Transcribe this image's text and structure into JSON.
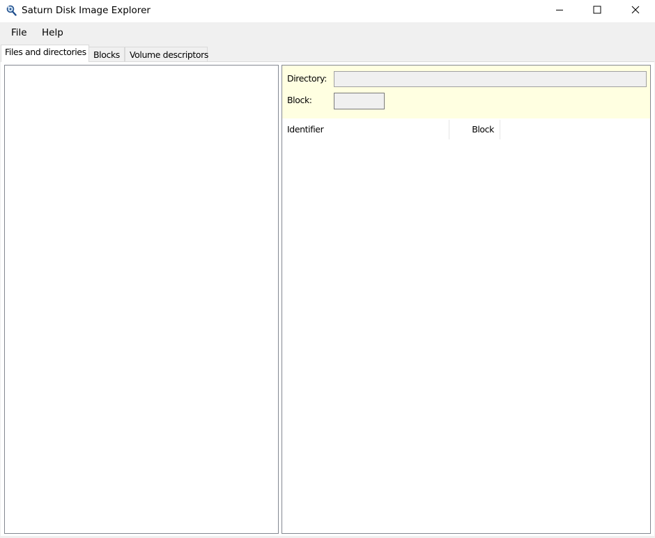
{
  "window": {
    "title": "Saturn Disk Image Explorer",
    "icon": "magnifier-disk-icon",
    "controls": {
      "minimize": "minimize-icon",
      "maximize": "maximize-icon",
      "close": "close-icon"
    }
  },
  "menu": {
    "items": [
      {
        "label": "File"
      },
      {
        "label": "Help"
      }
    ]
  },
  "tabs": [
    {
      "label": "Files and directories",
      "active": true
    },
    {
      "label": "Blocks",
      "active": false
    },
    {
      "label": "Volume descriptors",
      "active": false
    }
  ],
  "details": {
    "directory_label": "Directory:",
    "directory_value": "",
    "block_label": "Block:",
    "block_value": "",
    "info_background": "#ffffe1"
  },
  "list": {
    "columns": [
      {
        "label": "Identifier"
      },
      {
        "label": "Block"
      }
    ],
    "rows": []
  }
}
